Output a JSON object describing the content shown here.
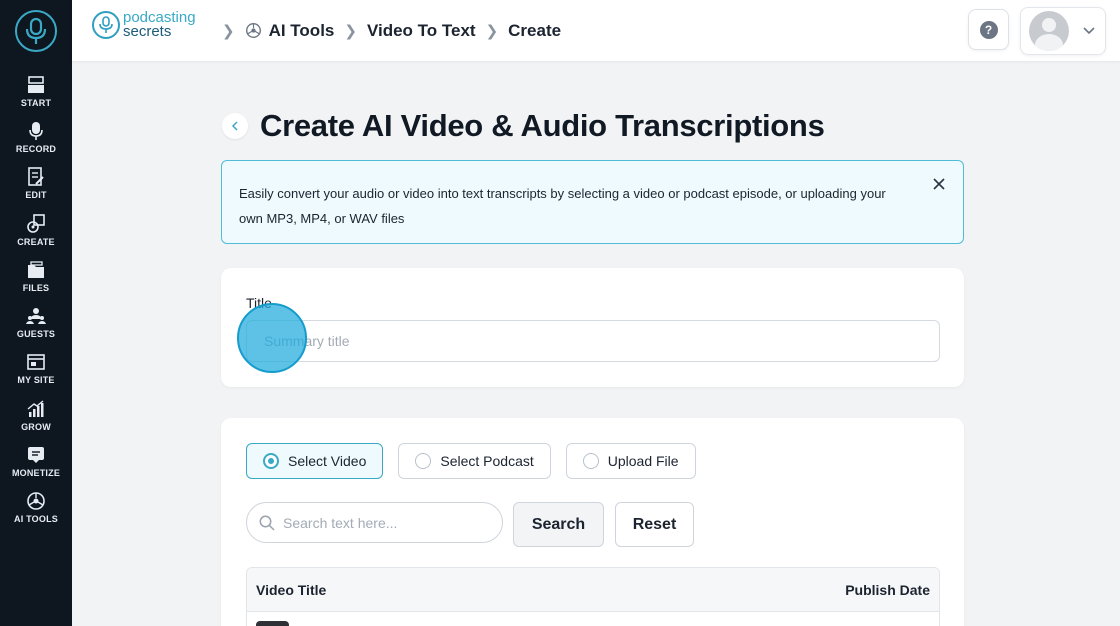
{
  "sidebar": {
    "items": [
      {
        "label": "START",
        "icon": "start-icon"
      },
      {
        "label": "RECORD",
        "icon": "microphone-icon"
      },
      {
        "label": "EDIT",
        "icon": "edit-icon"
      },
      {
        "label": "CREATE",
        "icon": "create-icon"
      },
      {
        "label": "FILES",
        "icon": "files-icon"
      },
      {
        "label": "GUESTS",
        "icon": "guests-icon"
      },
      {
        "label": "MY SITE",
        "icon": "site-icon"
      },
      {
        "label": "GROW",
        "icon": "grow-icon"
      },
      {
        "label": "MONETIZE",
        "icon": "monetize-icon"
      },
      {
        "label": "AI TOOLS",
        "icon": "ai-tools-icon"
      }
    ]
  },
  "brand": {
    "line1": "podcasting",
    "line2": "secrets"
  },
  "breadcrumb": {
    "item1": "AI Tools",
    "item2": "Video To Text",
    "item3": "Create"
  },
  "header": {
    "help": "?"
  },
  "page": {
    "title": "Create AI Video & Audio Transcriptions"
  },
  "info": {
    "text": "Easily convert your audio or video into text transcripts by selecting a video or podcast episode, or uploading your own MP3, MP4, or WAV files"
  },
  "form": {
    "title_label": "Title",
    "title_placeholder": "Summary title",
    "title_value": ""
  },
  "source": {
    "options": [
      {
        "label": "Select Video",
        "selected": true
      },
      {
        "label": "Select Podcast",
        "selected": false
      },
      {
        "label": "Upload File",
        "selected": false
      }
    ],
    "search_placeholder": "Search text here...",
    "search_button": "Search",
    "reset_button": "Reset"
  },
  "table": {
    "col_title": "Video Title",
    "col_date": "Publish Date"
  },
  "colors": {
    "sidebar_bg": "#0e1620",
    "accent": "#3aa9c6",
    "info_bg": "#eefafd"
  }
}
